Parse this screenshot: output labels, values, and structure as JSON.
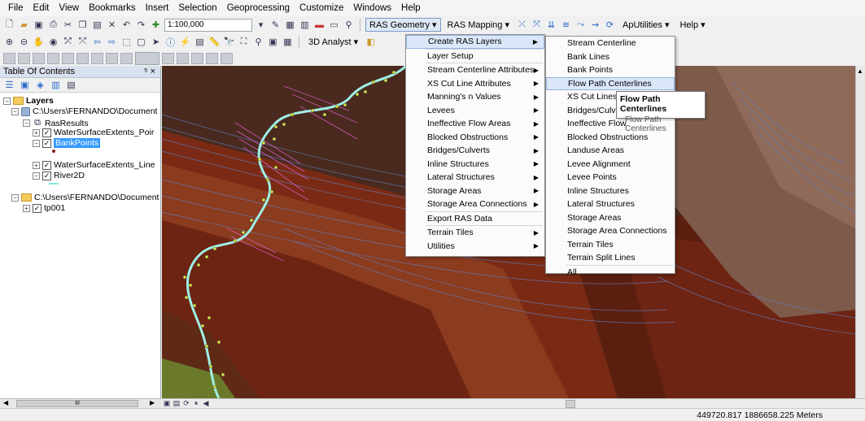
{
  "menubar": [
    "File",
    "Edit",
    "View",
    "Bookmarks",
    "Insert",
    "Selection",
    "Geoprocessing",
    "Customize",
    "Windows",
    "Help"
  ],
  "toolbar": {
    "scale": "1:100,000",
    "ras_geometry": "RAS Geometry",
    "ras_mapping": "RAS Mapping",
    "ap_utilities": "ApUtilities",
    "help": "Help",
    "analyst_3d": "3D Analyst"
  },
  "toc": {
    "title": "Table Of Contents",
    "pin": "⁵ ×",
    "layers_label": "Layers",
    "db1": "C:\\Users\\FERNANDO\\Document",
    "group": "RasResults",
    "items": [
      "WaterSurfaceExtents_Poir",
      "BankPoints",
      "WaterSurfaceExtents_Line",
      "River2D"
    ],
    "db2": "C:\\Users\\FERNANDO\\Document",
    "tp": "tp001"
  },
  "ras_geometry_menu": [
    {
      "label": "Create RAS Layers",
      "arrow": true,
      "highlighted": true
    },
    {
      "label": "Layer Setup",
      "arrow": false
    },
    {
      "label": "Stream Centerline Attributes",
      "arrow": true
    },
    {
      "label": "XS Cut Line Attributes",
      "arrow": true
    },
    {
      "label": "Manning's n Values",
      "arrow": true
    },
    {
      "label": "Levees",
      "arrow": true
    },
    {
      "label": "Ineffective Flow Areas",
      "arrow": true
    },
    {
      "label": "Blocked Obstructions",
      "arrow": true
    },
    {
      "label": "Bridges/Culverts",
      "arrow": true
    },
    {
      "label": "Inline Structures",
      "arrow": true
    },
    {
      "label": "Lateral Structures",
      "arrow": true
    },
    {
      "label": "Storage Areas",
      "arrow": true
    },
    {
      "label": "Storage Area Connections",
      "arrow": true
    },
    {
      "label": "Export RAS Data",
      "arrow": false
    },
    {
      "label": "Terrain Tiles",
      "arrow": true
    },
    {
      "label": "Utilities",
      "arrow": true
    }
  ],
  "create_layers_menu": [
    "Stream Centerline",
    "Bank Lines",
    "Bank Points",
    "Flow Path Centerlines",
    "XS Cut Lines",
    "Bridges/Culvert",
    "Ineffective Flow",
    "Blocked Obstructions",
    "Landuse Areas",
    "Levee Alignment",
    "Levee Points",
    "Inline Structures",
    "Lateral Structures",
    "Storage Areas",
    "Storage Area Connections",
    "Terrain Tiles",
    "Terrain Split Lines",
    "All"
  ],
  "tooltip": {
    "title": "Flow Path Centerlines",
    "body": "Flow Path Centerlines"
  },
  "status": {
    "coordinates": "449720.817  1886658.225 Meters"
  },
  "scroll": {
    "h_label": "III"
  },
  "colors": {
    "terrain_dark": "#6b2410",
    "terrain_mid": "#8a3a22",
    "river": "#9ff0e6",
    "lines_blue": "#5e82c8",
    "lines_pink": "#e05fd0",
    "highlight": "#dbe7f9"
  }
}
